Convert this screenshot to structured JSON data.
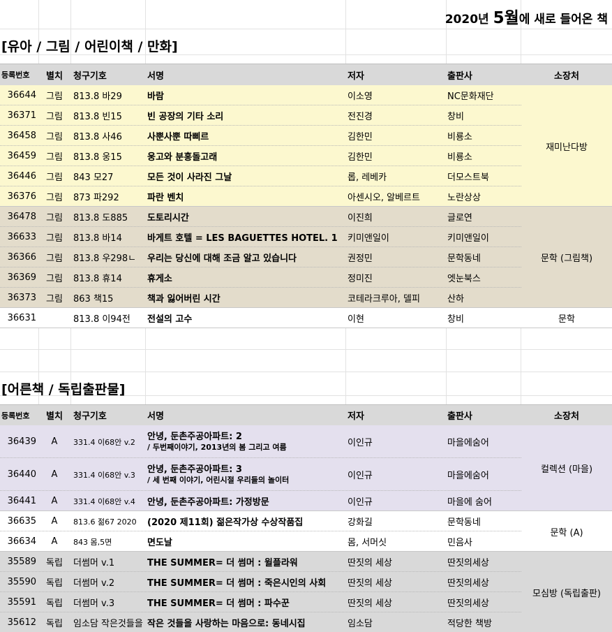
{
  "title": {
    "prefix": "2020년 ",
    "month": "5월",
    "suffix": "에 새로 들어온 책"
  },
  "section1": {
    "label": "[유아 / 그림 / 어린이책 / 만화]"
  },
  "section2": {
    "label": "[어른책 / 독립출판물]"
  },
  "headers": {
    "id": "등록번호",
    "sep": "별치",
    "call": "청구기호",
    "title": "서명",
    "author": "저자",
    "pub": "출판사",
    "loc": "소장처"
  },
  "group1": {
    "location": "재미난다방",
    "rows": [
      {
        "id": "36644",
        "sep": "그림",
        "call": "813.8 바29",
        "title": "바람",
        "author": "이소영",
        "pub": "NC문화재단"
      },
      {
        "id": "36371",
        "sep": "그림",
        "call": "813.8 빈15",
        "title": "빈 공장의 기타 소리",
        "author": "전진경",
        "pub": "창비"
      },
      {
        "id": "36458",
        "sep": "그림",
        "call": "813.8 사46",
        "title": "사뿐사뿐 따삐르",
        "author": "김한민",
        "pub": "비룡소"
      },
      {
        "id": "36459",
        "sep": "그림",
        "call": "813.8 웅15",
        "title": "웅고와 분홍돌고래",
        "author": "김한민",
        "pub": "비룡소"
      },
      {
        "id": "36446",
        "sep": "그림",
        "call": "843 모27",
        "title": "모든 것이 사라진 그날",
        "author": "롭, 레베카",
        "pub": "더모스트북"
      },
      {
        "id": "36376",
        "sep": "그림",
        "call": "873 파292",
        "title": "파란 벤치",
        "author": "아센시오, 알베르트",
        "pub": "노란상상"
      }
    ]
  },
  "group2": {
    "location": "문학 (그림책)",
    "rows": [
      {
        "id": "36478",
        "sep": "그림",
        "call": "813.8 도885",
        "title": "도토리시간",
        "author": "이진희",
        "pub": "글로연"
      },
      {
        "id": "36633",
        "sep": "그림",
        "call": "813.8 바14",
        "title": "바게트 호텔 = LES BAGUETTES HOTEL. 1",
        "author": "키미앤일이",
        "pub": "키미앤일이"
      },
      {
        "id": "36366",
        "sep": "그림",
        "call": "813.8 우298ㄴ",
        "title": "우리는 당신에 대해 조금 알고 있습니다",
        "author": "권정민",
        "pub": "문학동네"
      },
      {
        "id": "36369",
        "sep": "그림",
        "call": "813.8 휴14",
        "title": "휴게소",
        "author": "정미진",
        "pub": "엣눈북스"
      },
      {
        "id": "36373",
        "sep": "그림",
        "call": "863 책15",
        "title": "책과 잃어버린 시간",
        "author": "코테라크루아, 델피",
        "pub": "산하"
      }
    ]
  },
  "group3": {
    "location": "문학",
    "rows": [
      {
        "id": "36631",
        "sep": "",
        "call": "813.8 이94전",
        "title": "전설의 고수",
        "author": "이현",
        "pub": "창비"
      }
    ]
  },
  "group4": {
    "location": "컬렉션 (마을)",
    "rows": [
      {
        "id": "36439",
        "sep": "A",
        "call": "331.4 이68안 v.2",
        "title": "안녕, 둔촌주공아파트: 2",
        "subtitle": "/ 두번째이야기, 2013년의 봄 그리고 여름",
        "author": "이인규",
        "pub": "마을에숨어"
      },
      {
        "id": "36440",
        "sep": "A",
        "call": "331.4 이68안 v.3",
        "title": "안녕, 둔촌주공아파트: 3",
        "subtitle": "/ 세 번째 이야기, 어린시절 우리들의 놀이터",
        "author": "이인규",
        "pub": "마을에숨어"
      },
      {
        "id": "36441",
        "sep": "A",
        "call": "331.4 이68안 v.4",
        "title": "안녕, 둔촌주공아파트: 가정방문",
        "author": "이인규",
        "pub": "마을에 숨어"
      }
    ]
  },
  "group5": {
    "location": "문학 (A)",
    "rows": [
      {
        "id": "36635",
        "sep": "A",
        "call": "813.6 젊67 2020",
        "title": "(2020 제11회) 젊은작가상 수상작품집",
        "author": "강화길",
        "pub": "문학동네"
      },
      {
        "id": "36634",
        "sep": "A",
        "call": "843 몸,5면",
        "title": "면도날",
        "author": "몸, 서머싯",
        "pub": "민음사"
      }
    ]
  },
  "group6": {
    "location": "모심방 (독립출판)",
    "rows": [
      {
        "id": "35589",
        "sep": "독립",
        "call": "더썸머 v.1",
        "title": "THE SUMMER= 더 썸머 : 윌플라워",
        "author": "딴짓의 세상",
        "pub": "딴짓의세상"
      },
      {
        "id": "35590",
        "sep": "독립",
        "call": "더썸머 v.2",
        "title": "THE SUMMER= 더 썸머 : 죽은시인의 사회",
        "author": "딴짓의 세상",
        "pub": "딴짓의세상"
      },
      {
        "id": "35591",
        "sep": "독립",
        "call": "더썸머 v.3",
        "title": "THE SUMMER= 더 썸머 : 파수꾼",
        "author": "딴짓의 세상",
        "pub": "딴짓의세상"
      },
      {
        "id": "35612",
        "sep": "독립",
        "call": "임소담 작은것들을",
        "title": "작은 것들을 사랑하는 마음으로: 동네시집",
        "author": "임소담",
        "pub": "적당한 책방"
      }
    ]
  }
}
